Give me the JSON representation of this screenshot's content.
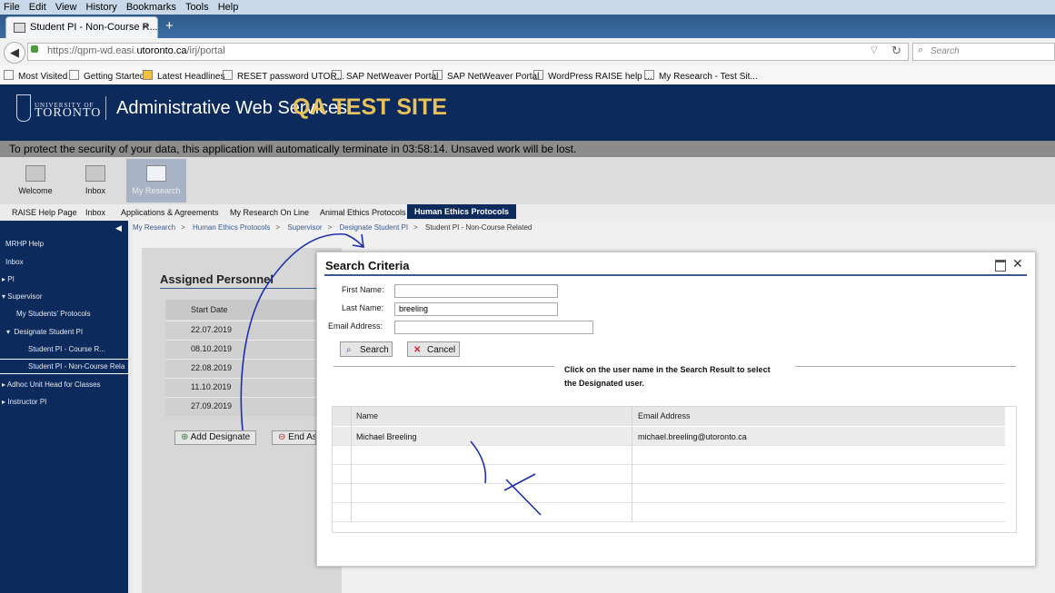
{
  "browser": {
    "menu": [
      "File",
      "Edit",
      "View",
      "History",
      "Bookmarks",
      "Tools",
      "Help"
    ],
    "tab_title": "Student PI - Non-Course R...",
    "url_prefix": "https://qpm-wd.easi.",
    "url_domain": "utoronto.ca",
    "url_path": "/irj/portal",
    "search_placeholder": "Search",
    "bookmarks": [
      "Most Visited",
      "Getting Started",
      "Latest Headlines",
      "RESET password UTOR...",
      "SAP NetWeaver Portal",
      "SAP NetWeaver Portal",
      "WordPress RAISE help ...",
      "My Research - Test Sit..."
    ]
  },
  "header": {
    "university_small": "UNIVERSITY OF",
    "university_big": "TORONTO",
    "app_name": "Administrative Web Services",
    "badge": "QA TEST SITE"
  },
  "timeout_message": "To protect the security of your data, this application will automatically terminate in 03:58:14. Unsaved work will be lost.",
  "top_nav": [
    "Welcome",
    "Inbox",
    "My Research"
  ],
  "sub_nav": [
    "RAISE Help Page",
    "Inbox",
    "Applications & Agreements",
    "My Research On Line",
    "Animal Ethics Protocols",
    "Human Ethics Protocols"
  ],
  "breadcrumb": [
    "My Research",
    "Human Ethics Protocols",
    "Supervisor",
    "Designate Student PI",
    "Student PI - Non-Course Related"
  ],
  "sidebar": [
    "MRHP Help",
    "Inbox",
    "PI",
    "Supervisor",
    "My Students' Protocols",
    "Designate Student PI",
    "Student PI - Course R...",
    "Student PI - Non-Course Rela",
    "Adhoc Unit Head for Classes",
    "Instructor PI"
  ],
  "assigned": {
    "title": "Assigned Personnel",
    "column": "Start Date",
    "dates": [
      "22.07.2019",
      "08.10.2019",
      "22.08.2019",
      "11.10.2019",
      "27.09.2019"
    ],
    "add_label": "Add Designate",
    "end_label": "End As"
  },
  "dialog": {
    "title": "Search Criteria",
    "first_name_label": "First Name:",
    "first_name_value": "",
    "last_name_label": "Last Name:",
    "last_name_value": "breeling",
    "email_label": "Email Address:",
    "email_value": "",
    "search_label": "Search",
    "cancel_label": "Cancel",
    "hint_line1": "Click on the user name in the Search Result to select",
    "hint_line2": "the Designated user.",
    "col_name": "Name",
    "col_email": "Email Address",
    "rows": [
      {
        "name": "Michael Breeling",
        "email": "michael.breeling@utoronto.ca"
      }
    ]
  },
  "colors": {
    "brand_navy": "#0c2a5c",
    "qa_gold": "#e8c15a",
    "ink_blue": "#1d2fb0"
  }
}
